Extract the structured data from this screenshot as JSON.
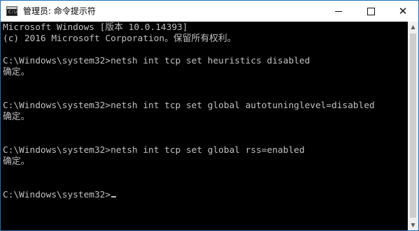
{
  "window": {
    "title": "管理员: 命令提示符",
    "icon_prompt": "C:\\>",
    "controls": {
      "minimize_icon": "minimize-icon",
      "maximize_icon": "maximize-icon",
      "close_icon": "close-icon",
      "close_glyph": "✕"
    }
  },
  "console": {
    "lines": [
      "Microsoft Windows [版本 10.0.14393]",
      "(c) 2016 Microsoft Corporation。保留所有权利。",
      "",
      "C:\\Windows\\system32>netsh int tcp set heuristics disabled",
      "确定。",
      "",
      "",
      "C:\\Windows\\system32>netsh int tcp set global autotuninglevel=disabled",
      "确定。",
      "",
      "",
      "C:\\Windows\\system32>netsh int tcp set global rss=enabled",
      "确定。",
      "",
      "",
      "C:\\Windows\\system32>"
    ]
  },
  "scrollbar": {
    "up_glyph": "▲",
    "down_glyph": "▼"
  },
  "colors": {
    "console_bg": "#000000",
    "console_fg": "#c0c0c0",
    "titlebar_bg": "#ffffff",
    "window_border": "#1e6fb8"
  }
}
